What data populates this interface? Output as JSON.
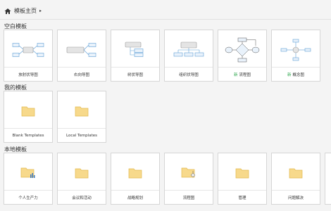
{
  "breadcrumb": {
    "title": "模板主页",
    "chevron": "▸"
  },
  "sections": {
    "blank": {
      "title": "空白模板"
    },
    "mine": {
      "title": "我的模板"
    },
    "local": {
      "title": "本地模板"
    }
  },
  "blank_templates": [
    {
      "label": "放射状导图",
      "icon": "radial-mindmap-icon"
    },
    {
      "label": "右向导图",
      "icon": "right-mindmap-icon"
    },
    {
      "label": "树状导图",
      "icon": "tree-chart-icon"
    },
    {
      "label": "组织状导图",
      "icon": "org-chart-icon"
    },
    {
      "label": "流程图",
      "badge": "新",
      "icon": "flowchart-icon"
    },
    {
      "label": "概念图",
      "badge": "新",
      "icon": "concept-map-icon"
    }
  ],
  "my_templates": [
    {
      "label": "Blank Templates",
      "icon": "folder-icon"
    },
    {
      "label": "Local Templates",
      "icon": "folder-icon"
    }
  ],
  "local_templates": [
    {
      "label": "个人生产力",
      "icon": "folder-chart-icon"
    },
    {
      "label": "会议和活动",
      "icon": "folder-icon"
    },
    {
      "label": "战略规划",
      "icon": "folder-icon"
    },
    {
      "label": "流程图",
      "icon": "folder-flow-icon"
    },
    {
      "label": "管理",
      "icon": "folder-icon"
    },
    {
      "label": "问题解决",
      "icon": "folder-icon"
    }
  ],
  "colors": {
    "node_fill": "#e9f2fb",
    "node_stroke": "#5f9fd6",
    "gray_fill": "#e4e4e4",
    "gray_stroke": "#9a9a9a",
    "folder": "#f7d98b",
    "folder_stroke": "#e2b94e"
  }
}
